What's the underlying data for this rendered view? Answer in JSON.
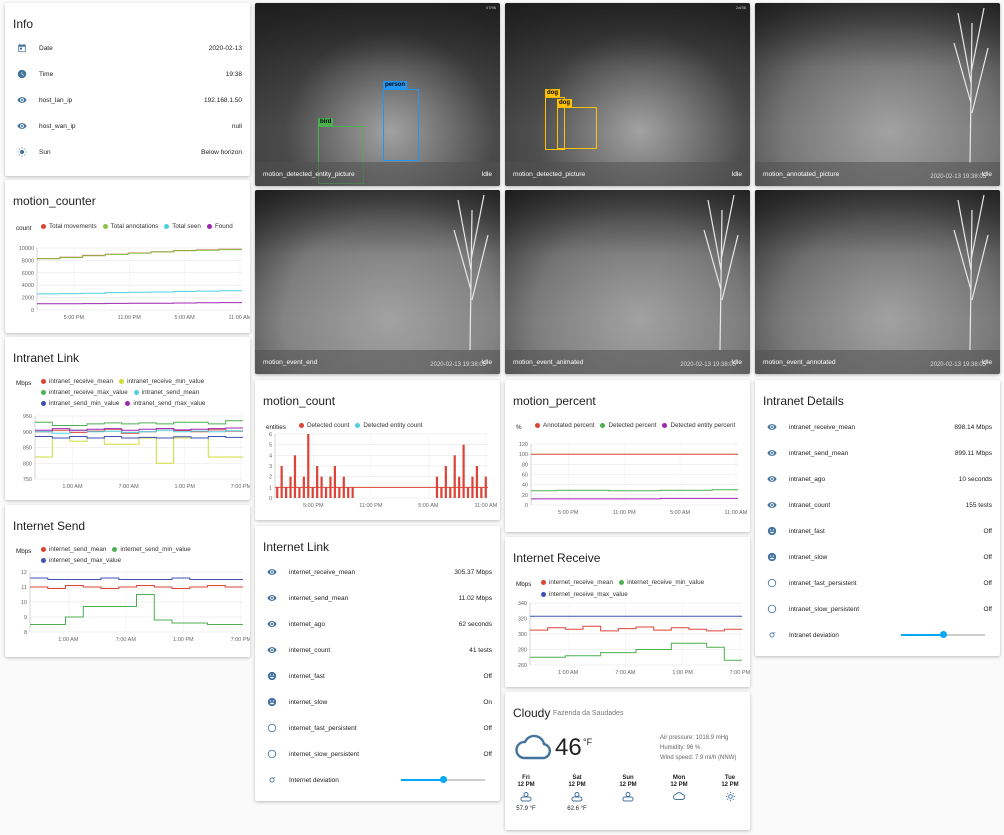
{
  "info": {
    "title": "Info",
    "rows": [
      {
        "icon": "calendar-icon",
        "name": "Date",
        "value": "2020-02-13"
      },
      {
        "icon": "clock-icon",
        "name": "Time",
        "value": "19:38"
      },
      {
        "icon": "eye-icon",
        "name": "host_lan_ip",
        "value": "192.168.1.50"
      },
      {
        "icon": "eye-icon",
        "name": "host_wan_ip",
        "value": "null"
      },
      {
        "icon": "sun-icon",
        "name": "Sun",
        "value": "Below horizon"
      }
    ]
  },
  "motion_counter": {
    "title": "motion_counter",
    "chart_data": {
      "type": "line",
      "unit": "count",
      "ylim": [
        0,
        10000
      ],
      "yticks": [
        "10000",
        "8000",
        "6000",
        "4000",
        "2000",
        "0"
      ],
      "xticks": [
        "5:00 PM",
        "11:00 PM",
        "5:00 AM",
        "11:00 AM"
      ],
      "series": [
        {
          "name": "Total movements",
          "color": "#db4437",
          "values": [
            8300,
            8500,
            8800,
            9000,
            9200,
            9400,
            9600,
            9700,
            9800
          ]
        },
        {
          "name": "Total annotations",
          "color": "#8bc34a",
          "values": [
            8250,
            8450,
            8750,
            8950,
            9150,
            9350,
            9550,
            9650,
            9750
          ]
        },
        {
          "name": "Total seen",
          "color": "#4dd0e1",
          "values": [
            2600,
            2650,
            2700,
            2800,
            2850,
            2900,
            3000,
            3050,
            3100
          ]
        },
        {
          "name": "Found",
          "color": "#9c27b0",
          "values": [
            1000,
            1020,
            1040,
            1060,
            1080,
            1100,
            1130,
            1160,
            1200
          ]
        }
      ]
    }
  },
  "intranet_link": {
    "title": "Intranet Link",
    "chart_data": {
      "type": "line",
      "unit": "Mbps",
      "ylim": [
        750,
        950
      ],
      "yticks": [
        "950",
        "900",
        "850",
        "800",
        "750"
      ],
      "xticks": [
        "1:00 AM",
        "7:00 AM",
        "1:00 PM",
        "7:00 PM"
      ],
      "series": [
        {
          "name": "intranet_receive_mean",
          "color": "#db4437",
          "values": [
            900,
            905,
            898,
            902,
            908,
            895,
            900,
            910,
            904,
            900,
            906,
            902
          ]
        },
        {
          "name": "intranet_receive_min_value",
          "color": "#cddc39",
          "values": [
            820,
            880,
            870,
            880,
            860,
            860,
            880,
            800,
            880,
            880,
            820,
            820
          ]
        },
        {
          "name": "intranet_receive_max_value",
          "color": "#4caf50",
          "values": [
            930,
            920,
            920,
            925,
            928,
            925,
            928,
            925,
            930,
            930,
            925,
            935
          ]
        },
        {
          "name": "intranet_send_mean",
          "color": "#4dd0e1",
          "values": [
            900,
            895,
            905,
            900,
            902,
            898,
            900,
            905,
            900,
            902,
            900,
            903
          ]
        },
        {
          "name": "intranet_send_min_value",
          "color": "#3f51b5",
          "values": [
            885,
            880,
            885,
            880,
            885,
            880,
            882,
            880,
            884,
            880,
            885,
            882
          ]
        },
        {
          "name": "intranet_send_max_value",
          "color": "#9c27b0",
          "values": [
            905,
            910,
            905,
            908,
            910,
            905,
            908,
            910,
            906,
            908,
            910,
            912
          ]
        }
      ]
    }
  },
  "internet_send": {
    "title": "Internet Send",
    "chart_data": {
      "type": "line",
      "unit": "Mbps",
      "ylim": [
        8,
        12
      ],
      "yticks": [
        "12",
        "11",
        "10",
        "9",
        "8"
      ],
      "xticks": [
        "1:00 AM",
        "7:00 AM",
        "1:00 PM",
        "7:00 PM"
      ],
      "series": [
        {
          "name": "internet_send_mean",
          "color": "#db4437",
          "values": [
            11.0,
            10.9,
            11.1,
            11.0,
            10.9,
            11.0,
            11.1,
            11.0,
            10.9,
            11.0,
            11.1,
            11.0
          ]
        },
        {
          "name": "internet_send_min_value",
          "color": "#4caf50",
          "values": [
            8.5,
            8.5,
            9.0,
            9.7,
            9.7,
            9.7,
            10.5,
            8.8,
            8.6,
            8.6,
            8.5,
            8.5
          ]
        },
        {
          "name": "internet_send_max_value",
          "color": "#3f51b5",
          "values": [
            11.6,
            11.5,
            11.5,
            11.5,
            11.6,
            11.5,
            11.5,
            11.5,
            11.6,
            11.5,
            11.5,
            11.5
          ]
        }
      ]
    }
  },
  "cameras": [
    {
      "name": "motion_detected_entity_picture",
      "status": "Idle",
      "timestamp": "",
      "tag": "07/96",
      "detections": [
        {
          "label": "person",
          "color": "#2196f3"
        },
        {
          "label": "bird",
          "color": "#4caf50"
        }
      ]
    },
    {
      "name": "motion_detected_picture",
      "status": "Idle",
      "timestamp": "",
      "tag": "2d/36",
      "detections": [
        {
          "label": "dog",
          "color": "#ffc107"
        },
        {
          "label": "dog",
          "color": "#ffc107"
        }
      ]
    },
    {
      "name": "motion_annotated_picture",
      "status": "Idle",
      "timestamp": "2020-02-13 19:38:05",
      "tag": "",
      "detections": []
    },
    {
      "name": "motion_event_end",
      "status": "Idle",
      "timestamp": "2020-02-13 19:38:05",
      "tag": "",
      "detections": []
    },
    {
      "name": "motion_event_animated",
      "status": "Idle",
      "timestamp": "2020-02-13 19:38:05",
      "tag": "",
      "detections": []
    },
    {
      "name": "motion_event_annotated",
      "status": "Idle",
      "timestamp": "2020-02-13 19:38:05",
      "tag": "",
      "detections": []
    }
  ],
  "motion_count": {
    "title": "motion_count",
    "chart_data": {
      "type": "bar",
      "unit": "entities",
      "ylim": [
        0,
        6
      ],
      "yticks": [
        "6",
        "5",
        "4",
        "3",
        "2",
        "1",
        "0"
      ],
      "xticks": [
        "5:00 PM",
        "11:00 PM",
        "5:00 AM",
        "11:00 AM"
      ],
      "series": [
        {
          "name": "Detected count",
          "color": "#db4437",
          "values": [
            1,
            3,
            1,
            2,
            4,
            1,
            2,
            6,
            1,
            3,
            2,
            1,
            2,
            3,
            1,
            2,
            1,
            1,
            0,
            0,
            0,
            0,
            0,
            0,
            0,
            0,
            0,
            0,
            0,
            0,
            0,
            0,
            0,
            0,
            0,
            0,
            2,
            1,
            3,
            1,
            4,
            2,
            5,
            1,
            2,
            3,
            1,
            2
          ]
        },
        {
          "name": "Detected entity count",
          "color": "#4dd0e1",
          "values": []
        }
      ]
    }
  },
  "motion_percent": {
    "title": "motion_percent",
    "chart_data": {
      "type": "line",
      "unit": "%",
      "ylim": [
        0,
        120
      ],
      "yticks": [
        "120",
        "100",
        "80",
        "60",
        "40",
        "20",
        "0"
      ],
      "xticks": [
        "5:00 PM",
        "11:00 PM",
        "5:00 AM",
        "11:00 AM"
      ],
      "series": [
        {
          "name": "Annotated percent",
          "color": "#db4437",
          "values": [
            100,
            100,
            100,
            100,
            100,
            100,
            100,
            100
          ]
        },
        {
          "name": "Detected percent",
          "color": "#4caf50",
          "values": [
            28,
            29,
            29,
            28,
            28,
            29,
            29,
            30
          ]
        },
        {
          "name": "Detected entity percent",
          "color": "#9c27b0",
          "values": [
            12,
            12,
            12,
            12,
            12,
            13,
            13,
            13
          ]
        }
      ]
    }
  },
  "internet_receive": {
    "title": "Internet Receive",
    "chart_data": {
      "type": "line",
      "unit": "Mbps",
      "ylim": [
        260,
        340
      ],
      "yticks": [
        "340",
        "320",
        "300",
        "280",
        "260"
      ],
      "xticks": [
        "1:00 AM",
        "7:00 AM",
        "1:00 PM",
        "7:00 PM"
      ],
      "series": [
        {
          "name": "internet_receive_mean",
          "color": "#db4437",
          "values": [
            305,
            308,
            306,
            310,
            304,
            307,
            309,
            305,
            308,
            306,
            304,
            306
          ]
        },
        {
          "name": "internet_receive_min_value",
          "color": "#4caf50",
          "values": [
            270,
            270,
            272,
            272,
            276,
            276,
            280,
            280,
            288,
            288,
            283,
            266
          ]
        },
        {
          "name": "internet_receive_max_value",
          "color": "#3f51b5",
          "values": [
            323,
            323,
            323,
            323,
            323,
            323,
            323,
            323,
            323,
            323,
            323,
            323
          ]
        }
      ]
    }
  },
  "internet_link": {
    "title": "Internet Link",
    "rows": [
      {
        "icon": "eye-icon",
        "name": "internet_receive_mean",
        "value": "305.37 Mbps"
      },
      {
        "icon": "eye-icon",
        "name": "internet_send_mean",
        "value": "11.02 Mbps"
      },
      {
        "icon": "eye-icon",
        "name": "internet_ago",
        "value": "62 seconds"
      },
      {
        "icon": "eye-icon",
        "name": "internet_count",
        "value": "41 tests"
      },
      {
        "icon": "smiley-icon",
        "name": "internet_fast",
        "value": "Off"
      },
      {
        "icon": "sad-icon",
        "name": "internet_slow",
        "value": "On"
      },
      {
        "icon": "circle-icon",
        "name": "internet_fast_persistent",
        "value": "Off"
      },
      {
        "icon": "circle-icon",
        "name": "internet_slow_persistent",
        "value": "Off"
      }
    ],
    "slider": {
      "icon": "sigma-icon",
      "name": "Internet deviation",
      "level": 0.5
    }
  },
  "intranet_details": {
    "title": "Intranet Details",
    "rows": [
      {
        "icon": "eye-icon",
        "name": "intranet_receive_mean",
        "value": "898.14 Mbps"
      },
      {
        "icon": "eye-icon",
        "name": "intranet_send_mean",
        "value": "899.11 Mbps"
      },
      {
        "icon": "eye-icon",
        "name": "intranet_ago",
        "value": "10 seconds"
      },
      {
        "icon": "eye-icon",
        "name": "intranet_count",
        "value": "155 tests"
      },
      {
        "icon": "smiley-icon",
        "name": "intranet_fast",
        "value": "Off"
      },
      {
        "icon": "sad-icon",
        "name": "intranet_slow",
        "value": "Off"
      },
      {
        "icon": "circle-icon",
        "name": "intranet_fast_persistent",
        "value": "Off"
      },
      {
        "icon": "circle-icon",
        "name": "intranet_slow_persistent",
        "value": "Off"
      }
    ],
    "slider": {
      "icon": "sigma-icon",
      "name": "Intranet deviation",
      "level": 0.5
    }
  },
  "weather": {
    "condition": "Cloudy",
    "location": "Fazenda da Saudades",
    "temperature": "46",
    "temp_unit": "°F",
    "air_pressure": "Air pressure: 1018.9 mHg",
    "humidity": "Humidity: 96 %",
    "wind": "Wind speed: 7.9 mi/h (NNW)",
    "forecast": [
      {
        "day": "Fri",
        "time": "12 PM",
        "icon": "partly-cloudy-icon",
        "temp": "57.9 °F"
      },
      {
        "day": "Sat",
        "time": "12 PM",
        "icon": "partly-cloudy-icon",
        "temp": "62.6 °F"
      },
      {
        "day": "Sun",
        "time": "12 PM",
        "icon": "partly-cloudy-icon",
        "temp": ""
      },
      {
        "day": "Mon",
        "time": "12 PM",
        "icon": "cloud-icon",
        "temp": ""
      },
      {
        "day": "Tue",
        "time": "12 PM",
        "icon": "sun-icon",
        "temp": ""
      }
    ]
  }
}
